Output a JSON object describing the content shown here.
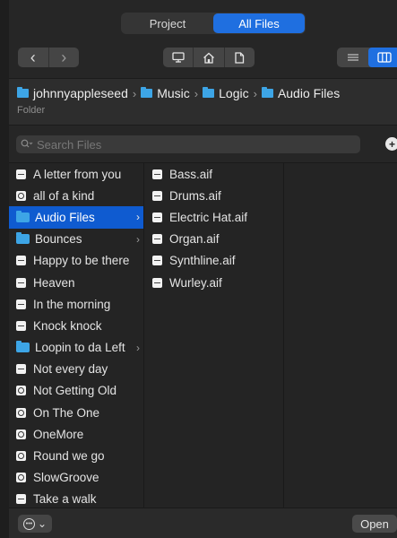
{
  "tabs": {
    "project": "Project",
    "all_files": "All Files"
  },
  "toolbar": {
    "back": "‹",
    "forward": "›",
    "computer_icon": "desktop-icon",
    "home_icon": "home-icon",
    "document_icon": "document-icon",
    "list_icon": "list-view-icon",
    "column_icon": "column-view-icon"
  },
  "path": {
    "crumbs": [
      "johnnyappleseed",
      "Music",
      "Logic",
      "Audio Files"
    ],
    "separator": "›",
    "kind": "Folder"
  },
  "search": {
    "placeholder": "Search Files",
    "add_symbol": "+"
  },
  "column1": [
    {
      "label": "A letter from you",
      "type": "audio"
    },
    {
      "label": "all of a kind",
      "type": "logic"
    },
    {
      "label": "Audio Files",
      "type": "folder",
      "selected": true
    },
    {
      "label": "Bounces",
      "type": "folder"
    },
    {
      "label": "Happy to be there",
      "type": "audio"
    },
    {
      "label": "Heaven",
      "type": "audio"
    },
    {
      "label": "In the morning",
      "type": "audio"
    },
    {
      "label": "Knock knock",
      "type": "audio"
    },
    {
      "label": "Loopin to da Left",
      "type": "folder"
    },
    {
      "label": "Not every day",
      "type": "audio"
    },
    {
      "label": "Not Getting Old",
      "type": "logic"
    },
    {
      "label": "On The One",
      "type": "logic"
    },
    {
      "label": "OneMore",
      "type": "logic"
    },
    {
      "label": "Round we go",
      "type": "logic"
    },
    {
      "label": "SlowGroove",
      "type": "logic"
    },
    {
      "label": "Take a walk",
      "type": "audio"
    }
  ],
  "column2": [
    {
      "label": "Bass.aif",
      "type": "audio"
    },
    {
      "label": "Drums.aif",
      "type": "audio"
    },
    {
      "label": "Electric Hat.aif",
      "type": "audio"
    },
    {
      "label": "Organ.aif",
      "type": "audio"
    },
    {
      "label": "Synthline.aif",
      "type": "audio"
    },
    {
      "label": "Wurley.aif",
      "type": "audio"
    }
  ],
  "footer": {
    "options_chevron": "⌄",
    "open": "Open"
  },
  "colors": {
    "accent": "#1f6fe0",
    "selection": "#0f5bd0",
    "folder": "#3da5e6"
  }
}
